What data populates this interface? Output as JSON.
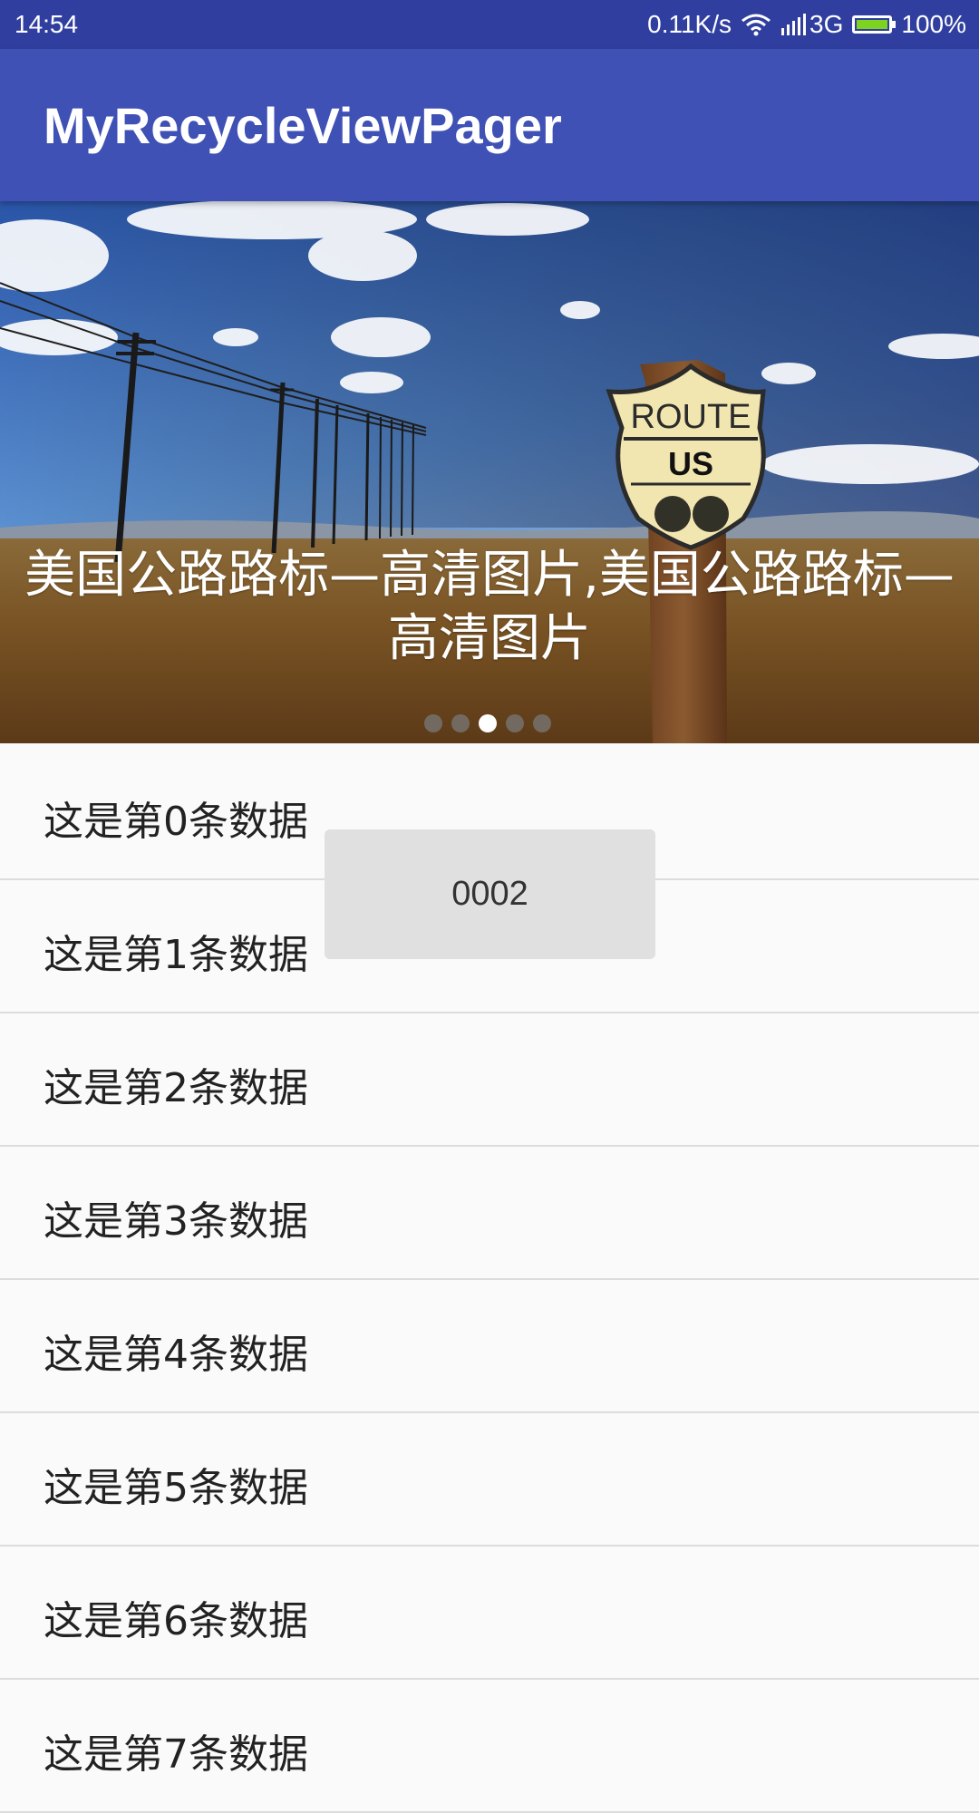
{
  "status_bar": {
    "time": "14:54",
    "speed": "0.11K/s",
    "network": "3G",
    "battery": "100%",
    "battery_level": 1.0,
    "icons": [
      "wifi-icon",
      "signal-icon",
      "battery-icon"
    ]
  },
  "app_bar": {
    "title": "MyRecycleViewPager"
  },
  "banner": {
    "caption": "美国公路路标—高清图片,美国公路路标—高清图片",
    "sign_text_top": "ROUTE",
    "sign_text_mid": "US",
    "page_count": 5,
    "active_page": 2
  },
  "list": {
    "items": [
      "这是第0条数据",
      "这是第1条数据",
      "这是第2条数据",
      "这是第3条数据",
      "这是第4条数据",
      "这是第5条数据",
      "这是第6条数据",
      "这是第7条数据"
    ]
  },
  "toast": {
    "text": "0002"
  },
  "colors": {
    "status_bar": "#303f9f",
    "app_bar": "#3f51b5",
    "battery_fill": "#7ed321",
    "list_background": "#fafafa"
  }
}
